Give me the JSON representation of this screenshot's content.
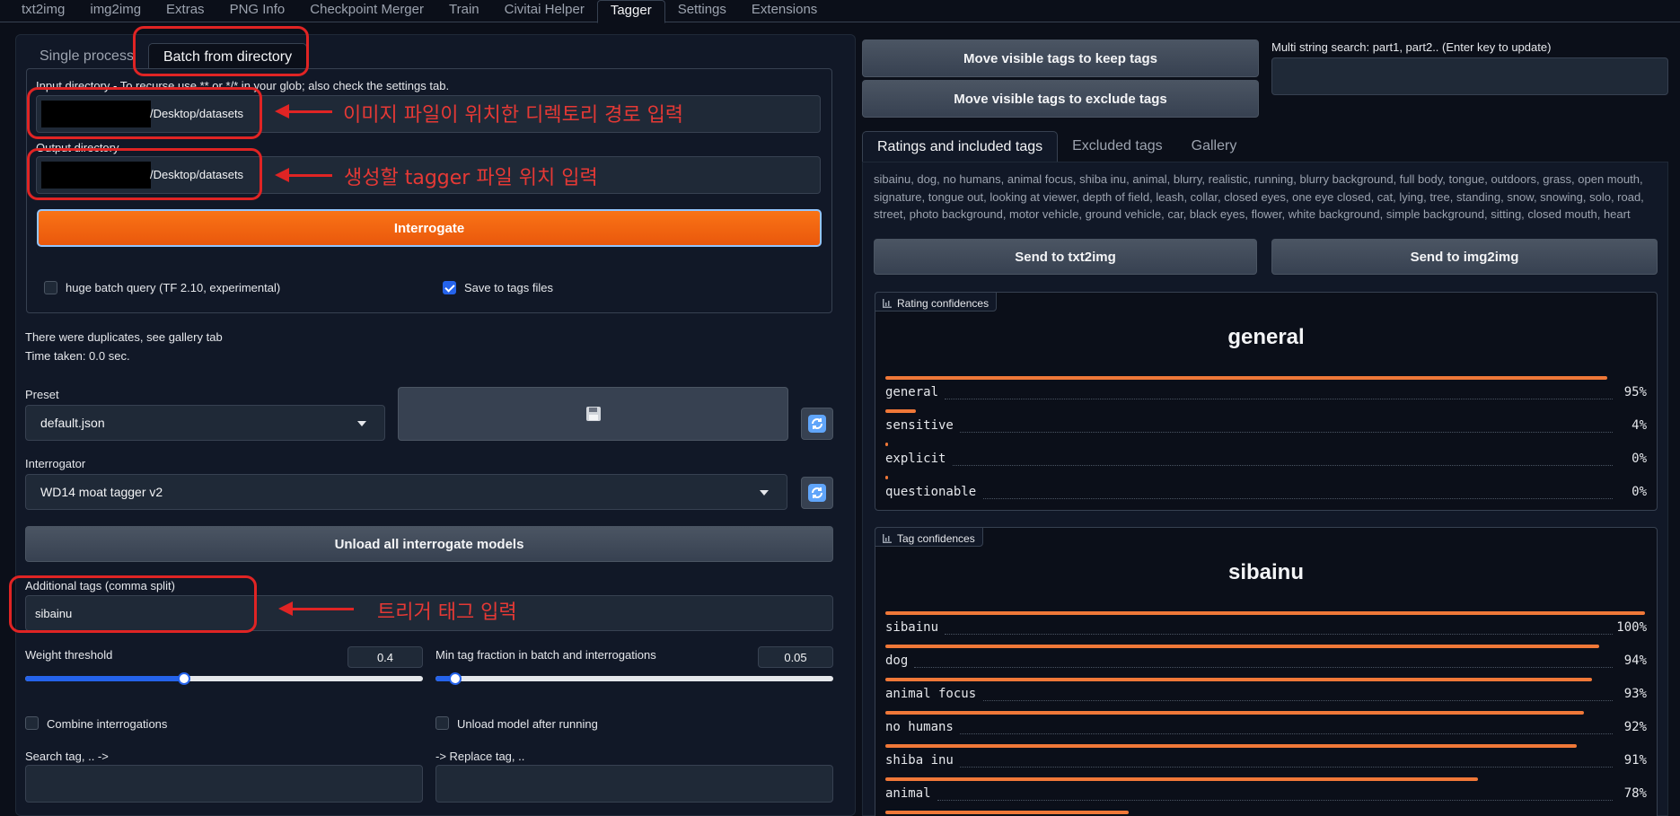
{
  "top_tabs": [
    "txt2img",
    "img2img",
    "Extras",
    "PNG Info",
    "Checkpoint Merger",
    "Train",
    "Civitai Helper",
    "Tagger",
    "Settings",
    "Extensions"
  ],
  "active_top_tab": "Tagger",
  "sub_tabs": [
    "Single process",
    "Batch from directory"
  ],
  "active_sub_tab": "Batch from directory",
  "batch": {
    "input_label": "Input directory - To recurse use ** or */* in your glob; also check the settings tab.",
    "input_value": "/Desktop/datasets",
    "output_label": "Output directory",
    "output_value": "/Desktop/datasets",
    "interrogate_label": "Interrogate",
    "huge_batch_label": "huge batch query (TF 2.10, experimental)",
    "huge_batch_checked": false,
    "save_tags_label": "Save to tags files",
    "save_tags_checked": true
  },
  "status": {
    "line1": "There were duplicates, see gallery tab",
    "line2": "Time taken: 0.0 sec."
  },
  "preset": {
    "label": "Preset",
    "value": "default.json",
    "save_icon": "floppy-disk-icon",
    "refresh_icon": "refresh-icon"
  },
  "interrogator": {
    "label": "Interrogator",
    "value": "WD14 moat tagger v2",
    "refresh_icon": "refresh-icon"
  },
  "unload_all_label": "Unload all interrogate models",
  "additional_tags": {
    "label": "Additional tags (comma split)",
    "value": "sibainu"
  },
  "weight_threshold": {
    "label": "Weight threshold",
    "value": "0.4",
    "fraction": 0.4
  },
  "min_tag_fraction": {
    "label": "Min tag fraction in batch and interrogations",
    "value": "0.05",
    "fraction": 0.05
  },
  "combine_label": "Combine interrogations",
  "unload_after_label": "Unload model after running",
  "search_tag_label": "Search tag, .. ->",
  "replace_tag_label": "-> Replace tag, ..",
  "annotations": {
    "input_note": "이미지 파일이 위치한 디렉토리 경로 입력",
    "output_note": "생성할 tagger 파일 위치 입력",
    "tags_note": "트리거 태그 입력"
  },
  "right": {
    "move_keep_label": "Move visible tags to keep tags",
    "move_exclude_label": "Move visible tags to exclude tags",
    "multi_search_label": "Multi string search: part1, part2.. (Enter key to update)",
    "tabs": [
      "Ratings and included tags",
      "Excluded tags",
      "Gallery"
    ],
    "active_tab": "Ratings and included tags",
    "tags_text": "sibainu, dog, no humans, animal focus, shiba inu, animal, blurry, realistic, running, blurry background, full body, tongue, outdoors, grass, open mouth, signature, tongue out, looking at viewer, depth of field, leash, collar, closed eyes, one eye closed, cat, lying, tree, standing, snow, snowing, solo, road, street, photo background, motor vehicle, ground vehicle, car, black eyes, flower, white background, simple background, sitting, closed mouth, heart",
    "send_txt2img": "Send to txt2img",
    "send_img2img": "Send to img2img",
    "rating_label": "Rating confidences",
    "rating_title": "general",
    "ratings": [
      {
        "name": "general",
        "pct": "95%",
        "value": 0.95
      },
      {
        "name": "sensitive",
        "pct": "4%",
        "value": 0.04
      },
      {
        "name": "explicit",
        "pct": "0%",
        "value": 0.003
      },
      {
        "name": "questionable",
        "pct": "0%",
        "value": 0.003
      }
    ],
    "tag_label": "Tag confidences",
    "tag_title": "sibainu",
    "tags": [
      {
        "name": "sibainu",
        "pct": "100%",
        "value": 1.0
      },
      {
        "name": "dog",
        "pct": "94%",
        "value": 0.94
      },
      {
        "name": "animal focus",
        "pct": "93%",
        "value": 0.93
      },
      {
        "name": "no humans",
        "pct": "92%",
        "value": 0.92
      },
      {
        "name": "shiba inu",
        "pct": "91%",
        "value": 0.91
      },
      {
        "name": "animal",
        "pct": "78%",
        "value": 0.78
      }
    ],
    "next_bar_value": 0.32
  }
}
